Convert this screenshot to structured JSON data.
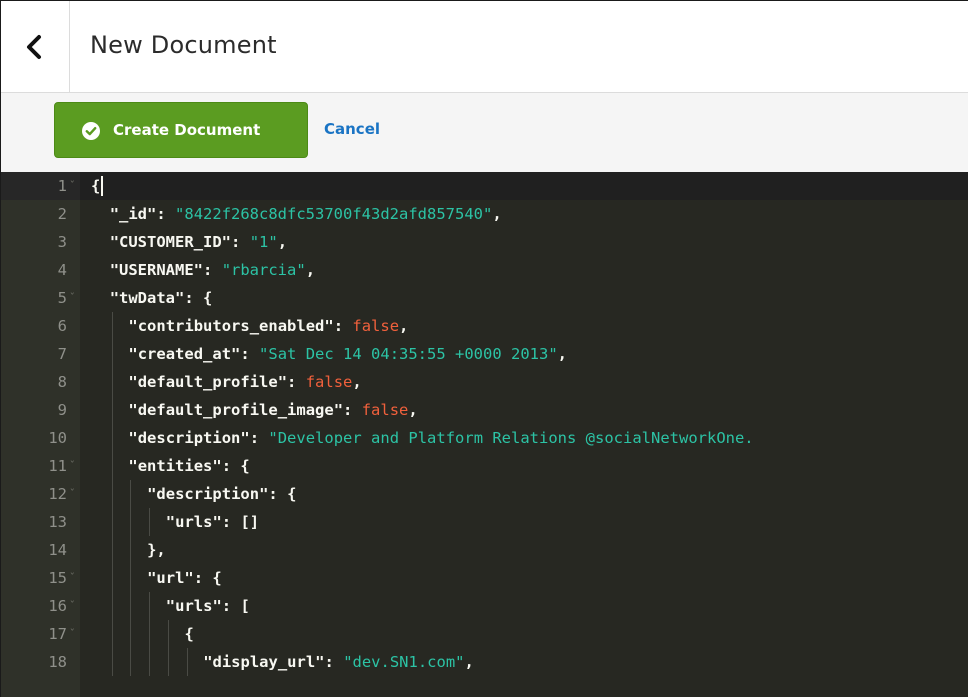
{
  "header": {
    "title": "New Document",
    "back_icon": "chevron-left-icon"
  },
  "toolbar": {
    "create_label": "Create Document",
    "create_icon": "check-circle-icon",
    "cancel_label": "Cancel"
  },
  "colors": {
    "create_button": "#5b9c21",
    "cancel_link": "#1a74c4",
    "editor_bg": "#272822",
    "string": "#2cc3a5",
    "boolean": "#f0603c"
  },
  "editor": {
    "lines": [
      {
        "n": "1",
        "fold": true,
        "indent": 0,
        "parts": [
          {
            "t": "{",
            "c": "punc"
          }
        ]
      },
      {
        "n": "2",
        "fold": false,
        "indent": 1,
        "parts": [
          {
            "t": "\"_id\"",
            "c": "key"
          },
          {
            "t": ": ",
            "c": "punc"
          },
          {
            "t": "\"8422f268c8dfc53700f43d2afd857540\"",
            "c": "str"
          },
          {
            "t": ",",
            "c": "punc"
          }
        ]
      },
      {
        "n": "3",
        "fold": false,
        "indent": 1,
        "parts": [
          {
            "t": "\"CUSTOMER_ID\"",
            "c": "key"
          },
          {
            "t": ": ",
            "c": "punc"
          },
          {
            "t": "\"1\"",
            "c": "str"
          },
          {
            "t": ",",
            "c": "punc"
          }
        ]
      },
      {
        "n": "4",
        "fold": false,
        "indent": 1,
        "parts": [
          {
            "t": "\"USERNAME\"",
            "c": "key"
          },
          {
            "t": ": ",
            "c": "punc"
          },
          {
            "t": "\"rbarcia\"",
            "c": "str"
          },
          {
            "t": ",",
            "c": "punc"
          }
        ]
      },
      {
        "n": "5",
        "fold": true,
        "indent": 1,
        "parts": [
          {
            "t": "\"twData\"",
            "c": "key"
          },
          {
            "t": ": {",
            "c": "punc"
          }
        ]
      },
      {
        "n": "6",
        "fold": false,
        "indent": 2,
        "parts": [
          {
            "t": "\"contributors_enabled\"",
            "c": "key"
          },
          {
            "t": ": ",
            "c": "punc"
          },
          {
            "t": "false",
            "c": "bool"
          },
          {
            "t": ",",
            "c": "punc"
          }
        ]
      },
      {
        "n": "7",
        "fold": false,
        "indent": 2,
        "parts": [
          {
            "t": "\"created_at\"",
            "c": "key"
          },
          {
            "t": ": ",
            "c": "punc"
          },
          {
            "t": "\"Sat Dec 14 04:35:55 +0000 2013\"",
            "c": "str"
          },
          {
            "t": ",",
            "c": "punc"
          }
        ]
      },
      {
        "n": "8",
        "fold": false,
        "indent": 2,
        "parts": [
          {
            "t": "\"default_profile\"",
            "c": "key"
          },
          {
            "t": ": ",
            "c": "punc"
          },
          {
            "t": "false",
            "c": "bool"
          },
          {
            "t": ",",
            "c": "punc"
          }
        ]
      },
      {
        "n": "9",
        "fold": false,
        "indent": 2,
        "parts": [
          {
            "t": "\"default_profile_image\"",
            "c": "key"
          },
          {
            "t": ": ",
            "c": "punc"
          },
          {
            "t": "false",
            "c": "bool"
          },
          {
            "t": ",",
            "c": "punc"
          }
        ]
      },
      {
        "n": "10",
        "fold": false,
        "indent": 2,
        "parts": [
          {
            "t": "\"description\"",
            "c": "key"
          },
          {
            "t": ": ",
            "c": "punc"
          },
          {
            "t": "\"Developer and Platform Relations @socialNetworkOne.",
            "c": "str"
          }
        ]
      },
      {
        "n": "11",
        "fold": true,
        "indent": 2,
        "parts": [
          {
            "t": "\"entities\"",
            "c": "key"
          },
          {
            "t": ": {",
            "c": "punc"
          }
        ]
      },
      {
        "n": "12",
        "fold": true,
        "indent": 3,
        "parts": [
          {
            "t": "\"description\"",
            "c": "key"
          },
          {
            "t": ": {",
            "c": "punc"
          }
        ]
      },
      {
        "n": "13",
        "fold": false,
        "indent": 4,
        "parts": [
          {
            "t": "\"urls\"",
            "c": "key"
          },
          {
            "t": ": ",
            "c": "punc"
          },
          {
            "t": "[]",
            "c": "punc"
          }
        ]
      },
      {
        "n": "14",
        "fold": false,
        "indent": 3,
        "parts": [
          {
            "t": "},",
            "c": "punc"
          }
        ]
      },
      {
        "n": "15",
        "fold": true,
        "indent": 3,
        "parts": [
          {
            "t": "\"url\"",
            "c": "key"
          },
          {
            "t": ": {",
            "c": "punc"
          }
        ]
      },
      {
        "n": "16",
        "fold": true,
        "indent": 4,
        "parts": [
          {
            "t": "\"urls\"",
            "c": "key"
          },
          {
            "t": ": [",
            "c": "punc"
          }
        ]
      },
      {
        "n": "17",
        "fold": true,
        "indent": 5,
        "parts": [
          {
            "t": "{",
            "c": "punc"
          }
        ]
      },
      {
        "n": "18",
        "fold": false,
        "indent": 6,
        "parts": [
          {
            "t": "\"display_url\"",
            "c": "key"
          },
          {
            "t": ": ",
            "c": "punc"
          },
          {
            "t": "\"dev.SN1.com\"",
            "c": "str"
          },
          {
            "t": ",",
            "c": "punc"
          }
        ]
      }
    ]
  }
}
